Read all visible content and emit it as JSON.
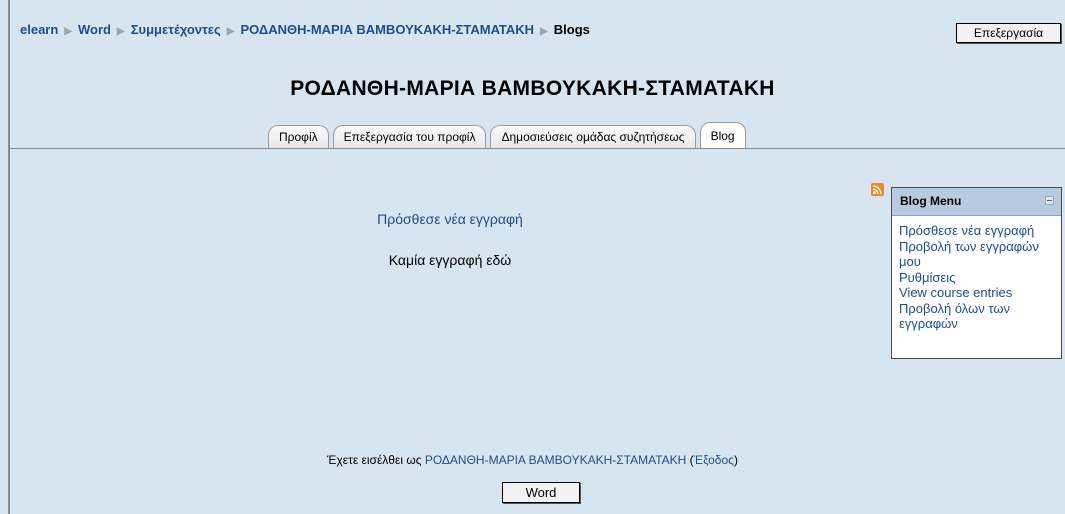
{
  "breadcrumb": {
    "items": [
      "elearn",
      "Word",
      "Συμμετέχοντες",
      "ΡΟΔΑΝΘΗ-ΜΑΡΙΑ ΒΑΜΒΟΥΚΑΚΗ-ΣΤΑΜΑΤΑΚΗ"
    ],
    "current": "Blogs"
  },
  "header": {
    "edit_button": "Επεξεργασία",
    "title": "ΡΟΔΑΝΘΗ-ΜΑΡΙΑ ΒΑΜΒΟΥΚΑΚΗ-ΣΤΑΜΑΤΑΚΗ"
  },
  "tabs": [
    {
      "label": "Προφίλ"
    },
    {
      "label": "Επεξεργασία του προφίλ"
    },
    {
      "label": "Δημοσιεύσεις ομάδας συζητήσεως"
    },
    {
      "label": "Blog"
    }
  ],
  "main": {
    "add_entry": "Πρόσθεσε νέα εγγραφή",
    "no_entries": "Καμία εγγραφή εδώ"
  },
  "blog_menu": {
    "title": "Blog Menu",
    "links": [
      "Πρόσθεσε νέα εγγραφή",
      "Προβολή των εγγραφών μου",
      "Ρυθμίσεις",
      "View course entries",
      "Προβολή όλων των εγγραφών"
    ]
  },
  "footer": {
    "logged_in_prefix": "Έχετε εισέλθει ως",
    "user_name": "ΡΟΔΑΝΘΗ-ΜΑΡΙΑ ΒΑΜΒΟΥΚΑΚΗ-ΣΤΑΜΑΤΑΚΗ",
    "logout": "Έξοδος",
    "course_button": "Word"
  },
  "colors": {
    "background": "#d6e5f0",
    "link": "#1f4e8c",
    "block_header": "#b6cbe0"
  }
}
